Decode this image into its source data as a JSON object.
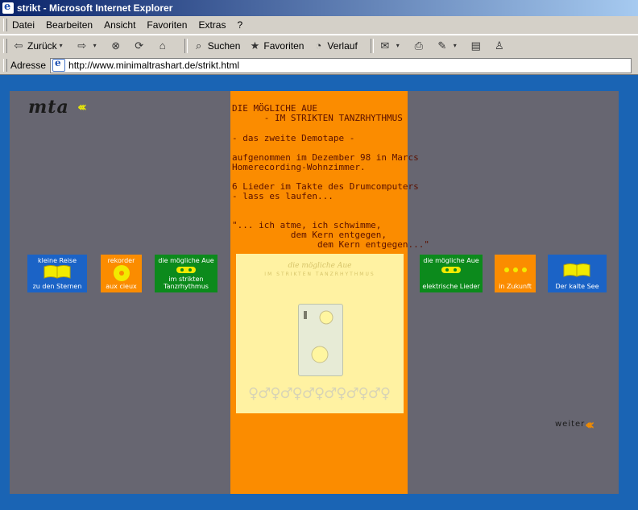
{
  "window": {
    "title": "strikt - Microsoft Internet Explorer"
  },
  "menu": [
    "Datei",
    "Bearbeiten",
    "Ansicht",
    "Favoriten",
    "Extras",
    "?"
  ],
  "toolbar": {
    "back": "Zurück",
    "search": "Suchen",
    "favorites": "Favoriten",
    "history": "Verlauf"
  },
  "address": {
    "label": "Adresse",
    "url": "http://www.minimaltrashart.de/strikt.html"
  },
  "page": {
    "logo": "mta",
    "header1": "DIE MÖGLICHE AUE",
    "header2": "      - IM STRIKTEN TANZRHYTHMUS",
    "subtitle": "- das zweite Demotape -",
    "rec1": "aufgenommen im Dezember 98 in Marcs",
    "rec2": "Homerecording-Wohnzimmer.",
    "lieder1": "6 Lieder im Takte des Drumcomputers",
    "lieder2": "- lass es laufen...",
    "quote1": "\"... ich atme, ich schwimme,",
    "quote2": "           dem Kern entgegen,",
    "quote3": "                dem Kern entgegen...\"",
    "tiles": {
      "kleine_reise": {
        "top": "kleine Reise",
        "bottom": "zu den Sternen",
        "color": "#1b63c6"
      },
      "rekorder": {
        "top": "rekorder",
        "bottom": "aux cieux",
        "color": "#fb8c00"
      },
      "moegliche_aue_left": {
        "top": "die mögliche Aue",
        "bottom1": "im strikten",
        "bottom2": "Tanzrhythmus",
        "color": "#0c8a1c"
      },
      "moegliche_aue_right": {
        "top": "die mögliche Aue",
        "bottom": "elektrische Lieder",
        "color": "#0c8a1c"
      },
      "in_zukunft": {
        "bottom": "in Zukunft",
        "color": "#fb8c00"
      },
      "der_kalte_see": {
        "bottom": "Der kalte See",
        "color": "#1b63c6"
      }
    },
    "cover": {
      "title": "die mögliche Aue",
      "subtitle": "IM STRIKTEN TANZRHYTHMUS"
    },
    "weiter": "weiter"
  }
}
